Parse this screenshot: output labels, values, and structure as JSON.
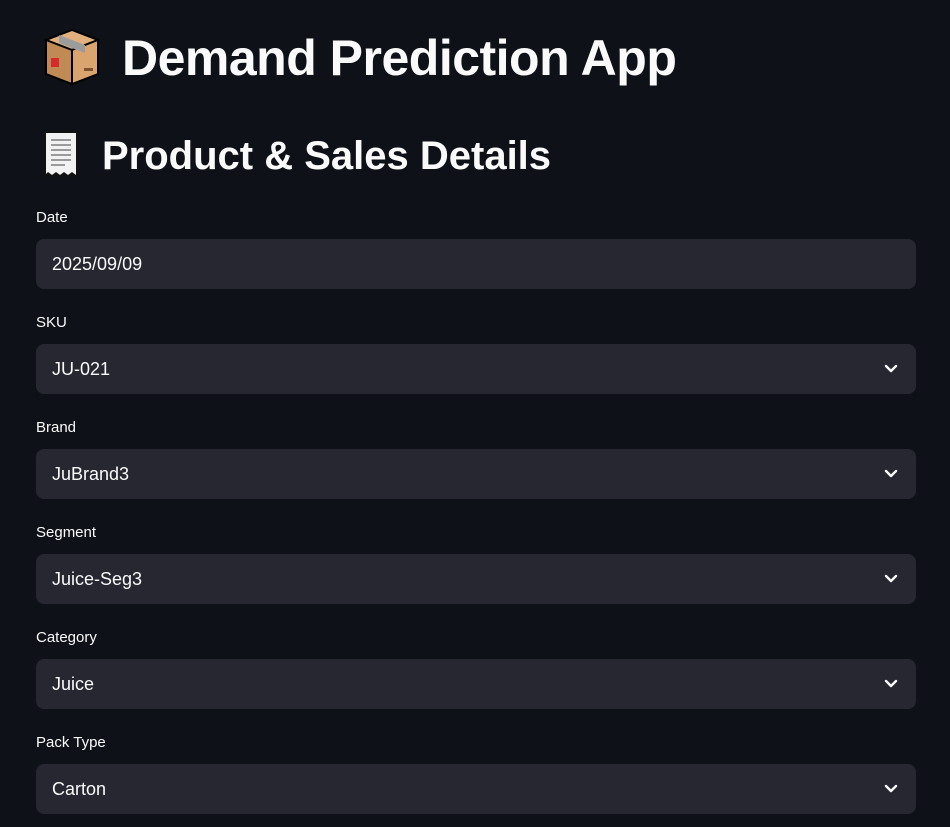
{
  "app": {
    "title": "Demand Prediction App",
    "title_icon": "package-icon"
  },
  "section": {
    "title": "Product & Sales Details",
    "title_icon": "receipt-icon"
  },
  "fields": {
    "date": {
      "label": "Date",
      "value": "2025/09/09"
    },
    "sku": {
      "label": "SKU",
      "value": "JU-021"
    },
    "brand": {
      "label": "Brand",
      "value": "JuBrand3"
    },
    "segment": {
      "label": "Segment",
      "value": "Juice-Seg3"
    },
    "category": {
      "label": "Category",
      "value": "Juice"
    },
    "pack_type": {
      "label": "Pack Type",
      "value": "Carton"
    }
  },
  "colors": {
    "background": "#0e1117",
    "input_background": "#262730",
    "text": "#fafafa"
  }
}
